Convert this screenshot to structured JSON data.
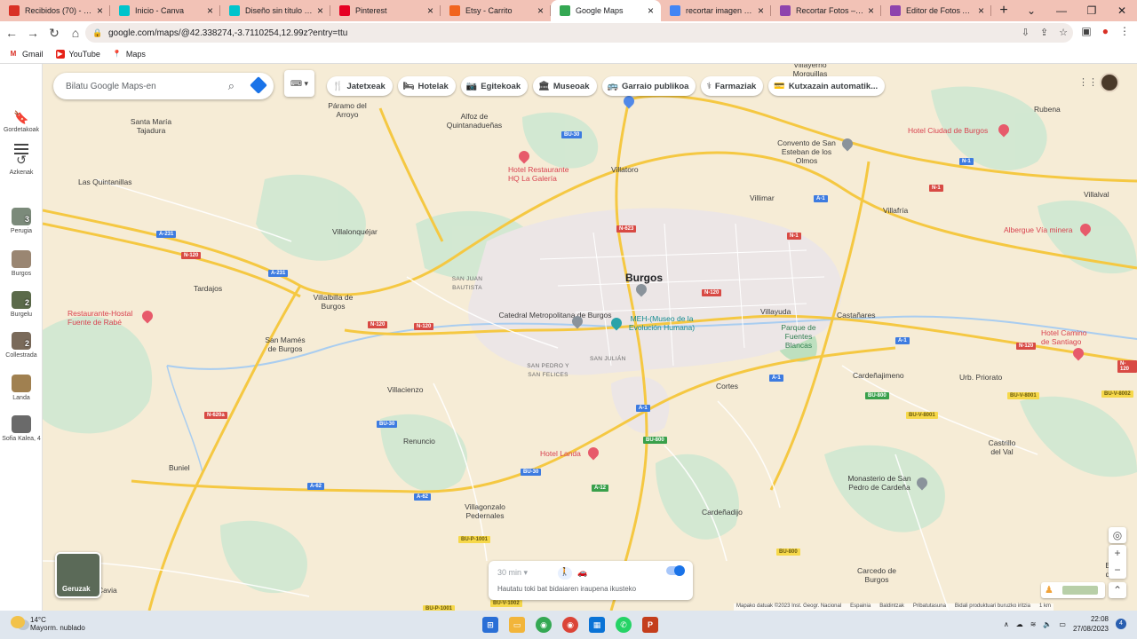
{
  "browser": {
    "tabs": [
      {
        "title": "Recibidos (70) - marar",
        "icon": "gmail-icon",
        "color": "#d93025"
      },
      {
        "title": "Inicio - Canva",
        "icon": "canva-icon",
        "color": "#00c4cc"
      },
      {
        "title": "Diseño sin título - Gra",
        "icon": "canva-icon",
        "color": "#00c4cc"
      },
      {
        "title": "Pinterest",
        "icon": "pinterest-icon",
        "color": "#e60023"
      },
      {
        "title": "Etsy - Carrito",
        "icon": "etsy-icon",
        "color": "#f1641e"
      },
      {
        "title": "Google Maps",
        "icon": "maps-icon",
        "color": "#34a853",
        "active": true
      },
      {
        "title": "recortar imagen con fo",
        "icon": "google-icon",
        "color": "#4285f4"
      },
      {
        "title": "Recortar Fotos – Reco",
        "icon": "photo-editor-icon",
        "color": "#8e44ad"
      },
      {
        "title": "Editor de Fotos AI - E",
        "icon": "photo-editor-icon",
        "color": "#8e44ad"
      }
    ],
    "url": "google.com/maps/@42.338274,-3.7110254,12.99z?entry=ttu",
    "bookmarks": [
      "Gmail",
      "YouTube",
      "Maps"
    ]
  },
  "maps": {
    "search_placeholder": "Bilatu Google Maps-en",
    "chips": [
      {
        "label": "Jatetxeak",
        "icon": "restaurant-icon",
        "glyph": "🍴"
      },
      {
        "label": "Hotelak",
        "icon": "hotel-icon",
        "glyph": "🛏"
      },
      {
        "label": "Egitekoak",
        "icon": "camera-icon",
        "glyph": "📷"
      },
      {
        "label": "Museoak",
        "icon": "museum-icon",
        "glyph": "🏛"
      },
      {
        "label": "Garraio publikoa",
        "icon": "transit-icon",
        "glyph": "🚌"
      },
      {
        "label": "Farmaziak",
        "icon": "pharmacy-icon",
        "glyph": "⚕"
      },
      {
        "label": "Kutxazain automatik...",
        "icon": "atm-icon",
        "glyph": "💳"
      }
    ],
    "rail": {
      "saved_label": "Gordetakoak",
      "recent_label": "Azkenak",
      "places": [
        {
          "label": "Perugia",
          "badge": "3"
        },
        {
          "label": "Burgos",
          "badge": ""
        },
        {
          "label": "Burgelu",
          "badge": "2"
        },
        {
          "label": "Collestrada",
          "badge": "2"
        },
        {
          "label": "Landa",
          "badge": ""
        },
        {
          "label": "Sofia Kalea, 4",
          "badge": ""
        }
      ]
    },
    "layers_label": "Geruzak",
    "travel": {
      "time": "30 min",
      "hint": "Hautatu toki bat bidaiaren iraupena ikusteko"
    },
    "attribution": [
      "Mapako datuak ©2023 Inst. Geogr. Nacional",
      "Espainia",
      "Baldintzak",
      "Pribatutasuna",
      "Bidali produktuari buruzko iritzia",
      "1 km"
    ],
    "labels": {
      "burgos": "Burgos",
      "villayerno": "Villayerno Morquillas",
      "paramo": "Páramo del Arroyo",
      "santa_maria": "Santa María Tajadura",
      "alfoz": "Alfoz de Quintanadueñas",
      "villatoro": "Villatoro",
      "convento": "Convento de San Esteban de los Olmos",
      "rubena": "Rubena",
      "villimar": "Villimar",
      "villafria": "Villafría",
      "villalval": "Villalval",
      "las_quintanillas": "Las Quintanillas",
      "villalonquejar": "Villalonquéjar",
      "tardajos": "Tardajos",
      "villalbilla": "Villalbilla de Burgos",
      "san_mames": "San Mamés de Burgos",
      "villacienzo": "Villacienzo",
      "renuncio": "Renuncio",
      "buniel": "Buniel",
      "cavia": "Cavia",
      "villagonzalo": "Villagonzalo Pedernales",
      "cardenadijo": "Cardeñadijo",
      "cortes": "Cortes",
      "villayuda": "Villayuda",
      "castanares": "Castañares",
      "cardenajimeno": "Cardeñajimeno",
      "orbaneja": "Urb. Priorato",
      "castrillo": "Castrillo del Val",
      "monasterio": "Monasterio de San Pedro de Cardeña",
      "carcedo": "Carcedo de Burgos",
      "espinosa": "Espin de Ju",
      "san_juan": "SAN JUAN BAUTISTA",
      "san_pedro": "SAN PEDRO Y SAN FELICES",
      "san_julian": "SAN JULIÁN",
      "catedral": "Catedral Metropolitana de Burgos",
      "meh": "MEH-(Museo de la Evolución Humana)",
      "parque": "Parque de Fuentes Blancas",
      "hotel_galeria": "Hotel Restaurante HQ La Galería",
      "hotel_ciudad": "Hotel Ciudad de Burgos",
      "albergue": "Albergue Vía minera",
      "restaurante_hostal": "Restaurante-Hostal Fuente de Rabé",
      "hotel_camino": "Hotel Camino de Santiago",
      "hotel_landa": "Hotel Landa"
    },
    "shields": [
      "BU-30",
      "A-1",
      "N-1",
      "A-231",
      "N-120",
      "N-623",
      "N-120",
      "A-231",
      "N-120",
      "N-120",
      "A-62",
      "A-62",
      "BU-30",
      "BU-30",
      "N-620a",
      "A-1",
      "BU-800",
      "A-1",
      "BU-800",
      "BU-V-8001",
      "BU-V-8002",
      "A-12",
      "N-120",
      "BU-P-1001",
      "BU-V-1002",
      "BU-P-1001",
      "BU-800",
      "BU-V-8001",
      "N-120",
      "A-1",
      "N-1",
      "N-1"
    ]
  },
  "taskbar": {
    "weather_temp": "14°C",
    "weather_desc": "Mayorm. nublado",
    "time": "22:08",
    "date": "27/08/2023",
    "notifications": "4"
  }
}
